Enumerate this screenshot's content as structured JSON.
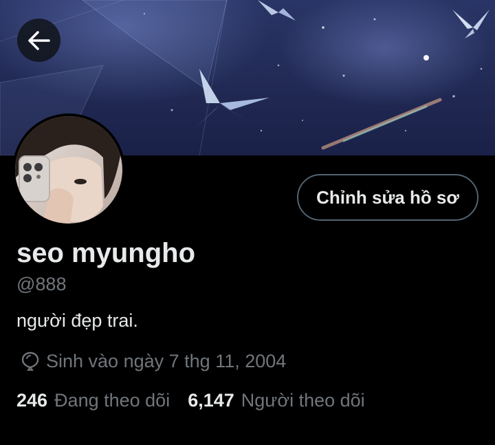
{
  "header": {
    "back_icon": "arrow-left-icon",
    "banner_description": "night sky with crystal butterflies"
  },
  "profile": {
    "edit_button_label": "Chỉnh sửa hồ sơ",
    "display_name": "seo myungho",
    "handle": "@888",
    "bio": "người đẹp trai.",
    "birthday_icon": "balloon-icon",
    "birthday_text": "Sinh vào ngày 7 thg 11, 2004",
    "following_count": "246",
    "following_label": "Đang theo dõi",
    "followers_count": "6,147",
    "followers_label": "Người theo dõi"
  },
  "colors": {
    "background": "#000000",
    "primary_text": "#e7e9ea",
    "secondary_text": "#71767b",
    "button_border": "#536471"
  }
}
